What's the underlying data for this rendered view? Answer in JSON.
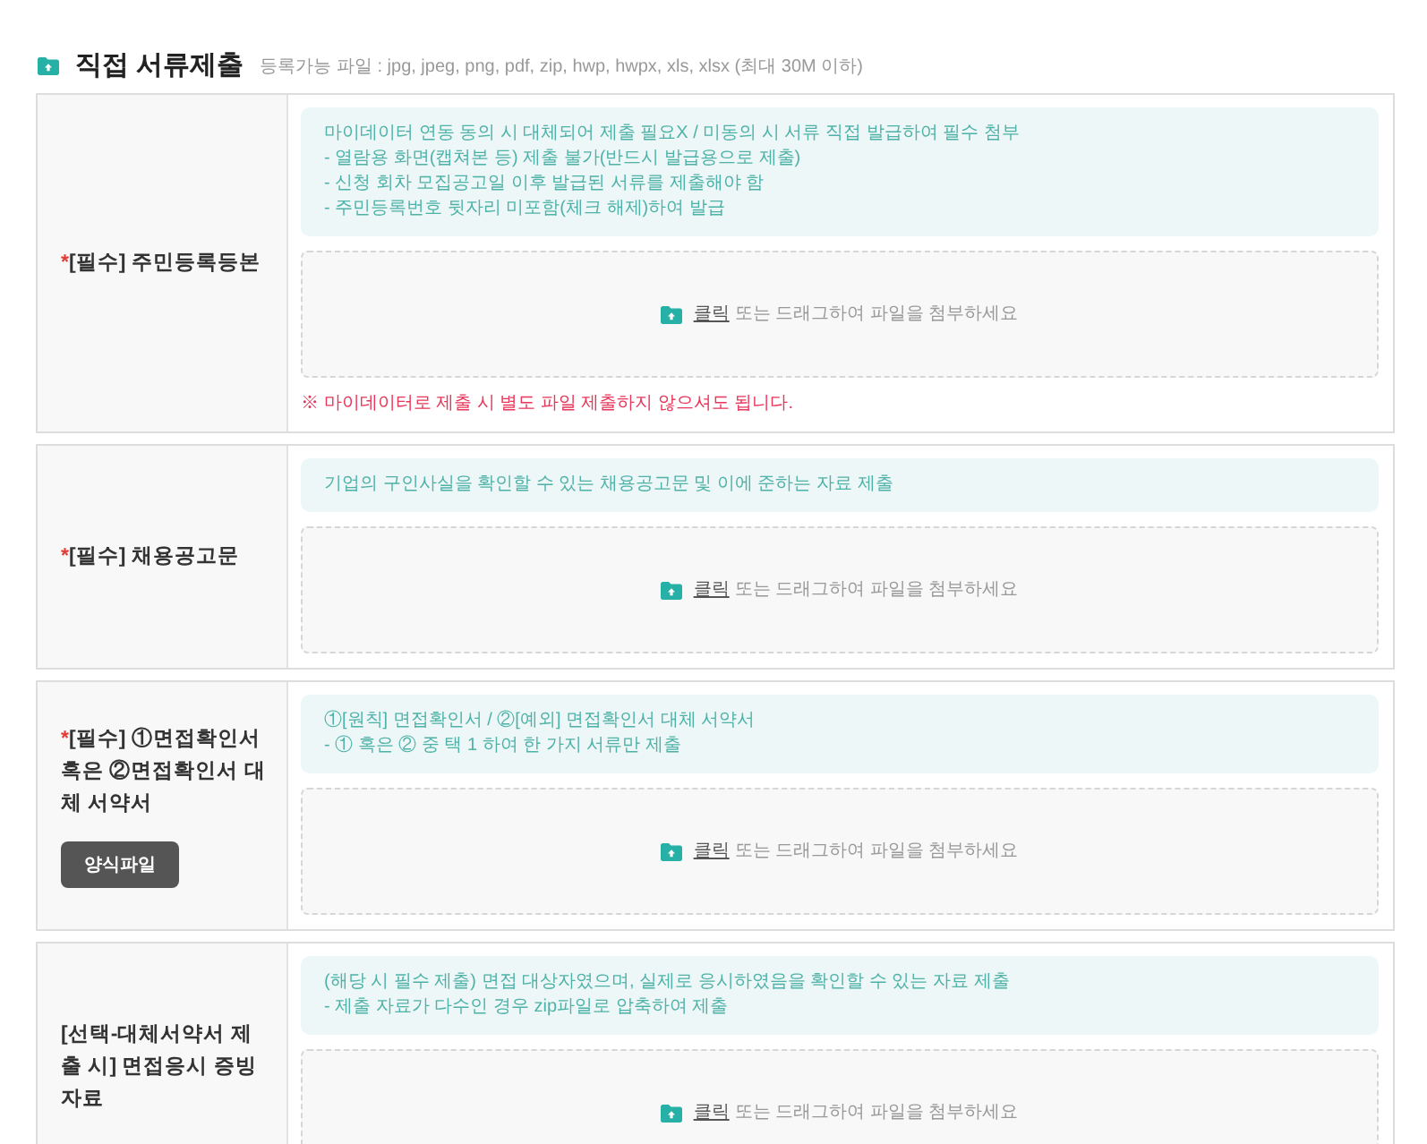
{
  "section": {
    "title": "직접 서류제출",
    "hint": "등록가능 파일 : jpg, jpeg, png, pdf, zip, hwp, hwpx, xls, xlsx (최대 30M 이하)"
  },
  "rows": [
    {
      "required_mark": "*",
      "label": "[필수] 주민등록등본",
      "info": [
        "마이데이터 연동 동의 시 대체되어 제출 필요X / 미동의 시 서류 직접 발급하여 필수 첨부",
        "- 열람용 화면(캡쳐본 등) 제출 불가(반드시 발급용으로 제출)",
        "- 신청 회차 모집공고일 이후 발급된 서류를 제출해야 함",
        "- 주민등록번호 뒷자리 미포함(체크 해제)하여 발급"
      ],
      "dropzone": {
        "link": "클릭",
        "text": "또는 드래그하여 파일을 첨부하세요"
      },
      "note": "※ 마이데이터로 제출 시 별도 파일 제출하지 않으셔도 됩니다."
    },
    {
      "required_mark": "*",
      "label": "[필수] 채용공고문",
      "info": [
        "기업의 구인사실을 확인할 수 있는 채용공고문 및 이에 준하는 자료 제출"
      ],
      "dropzone": {
        "link": "클릭",
        "text": "또는 드래그하여 파일을 첨부하세요"
      }
    },
    {
      "required_mark": "*",
      "label": "[필수] ①면접확인서 혹은 ②면접확인서 대체 서약서",
      "button": "양식파일",
      "info": [
        "①[원칙] 면접확인서 / ②[예외] 면접확인서 대체 서약서",
        "- ① 혹은 ② 중 택 1 하여 한 가지 서류만 제출"
      ],
      "dropzone": {
        "link": "클릭",
        "text": "또는 드래그하여 파일을 첨부하세요"
      }
    },
    {
      "label": "[선택-대체서약서 제출 시] 면접응시 증빙자료",
      "info": [
        "(해당 시 필수 제출) 면접 대상자였으며, 실제로 응시하였음을 확인할 수 있는 자료 제출",
        "- 제출 자료가 다수인 경우 zip파일로 압축하여 제출"
      ],
      "dropzone": {
        "link": "클릭",
        "text": "또는 드래그하여 파일을 첨부하세요"
      }
    }
  ]
}
